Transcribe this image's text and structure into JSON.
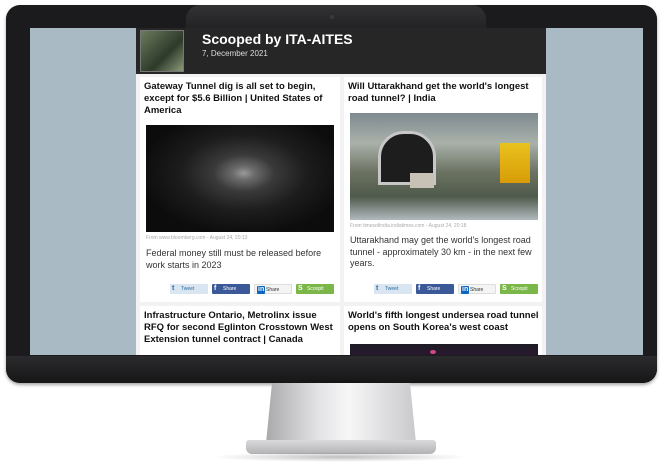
{
  "topic": {
    "title": "Scooped by ITA-AITES",
    "date": "7, December 2021"
  },
  "cards": [
    {
      "title": "Gateway Tunnel dig is all set to begin, except for $5.6 Billion | United States of America",
      "image": "tunnel-interior",
      "source": "From www.bloomberg.com - August 24, 20:13",
      "summary": "Federal money still must be released before work starts in 2023",
      "share": {
        "tweet": "Tweet",
        "facebook": "Share",
        "linkedin": "Share",
        "scoopit": "Scoopit"
      }
    },
    {
      "title": "Will Uttarakhand get the world's longest road tunnel? | India",
      "image": "tunnel-portal-construction",
      "source": "From timesofindia.indiatimes.com - August 24, 20:18",
      "summary": "Uttarakhand may get the world's longest road tunnel - approximately 30 km - in the next few years.",
      "share": {
        "tweet": "Tweet",
        "facebook": "Share",
        "linkedin": "Share",
        "scoopit": "Scoopit"
      }
    },
    {
      "title": "Infrastructure Ontario, Metrolinx issue RFQ for second Eglinton Crosstown West Extension tunnel contract | Canada"
    },
    {
      "title": "World's fifth longest undersea road tunnel opens on South Korea's west coast",
      "image": "undersea-tunnel-dark"
    }
  ]
}
